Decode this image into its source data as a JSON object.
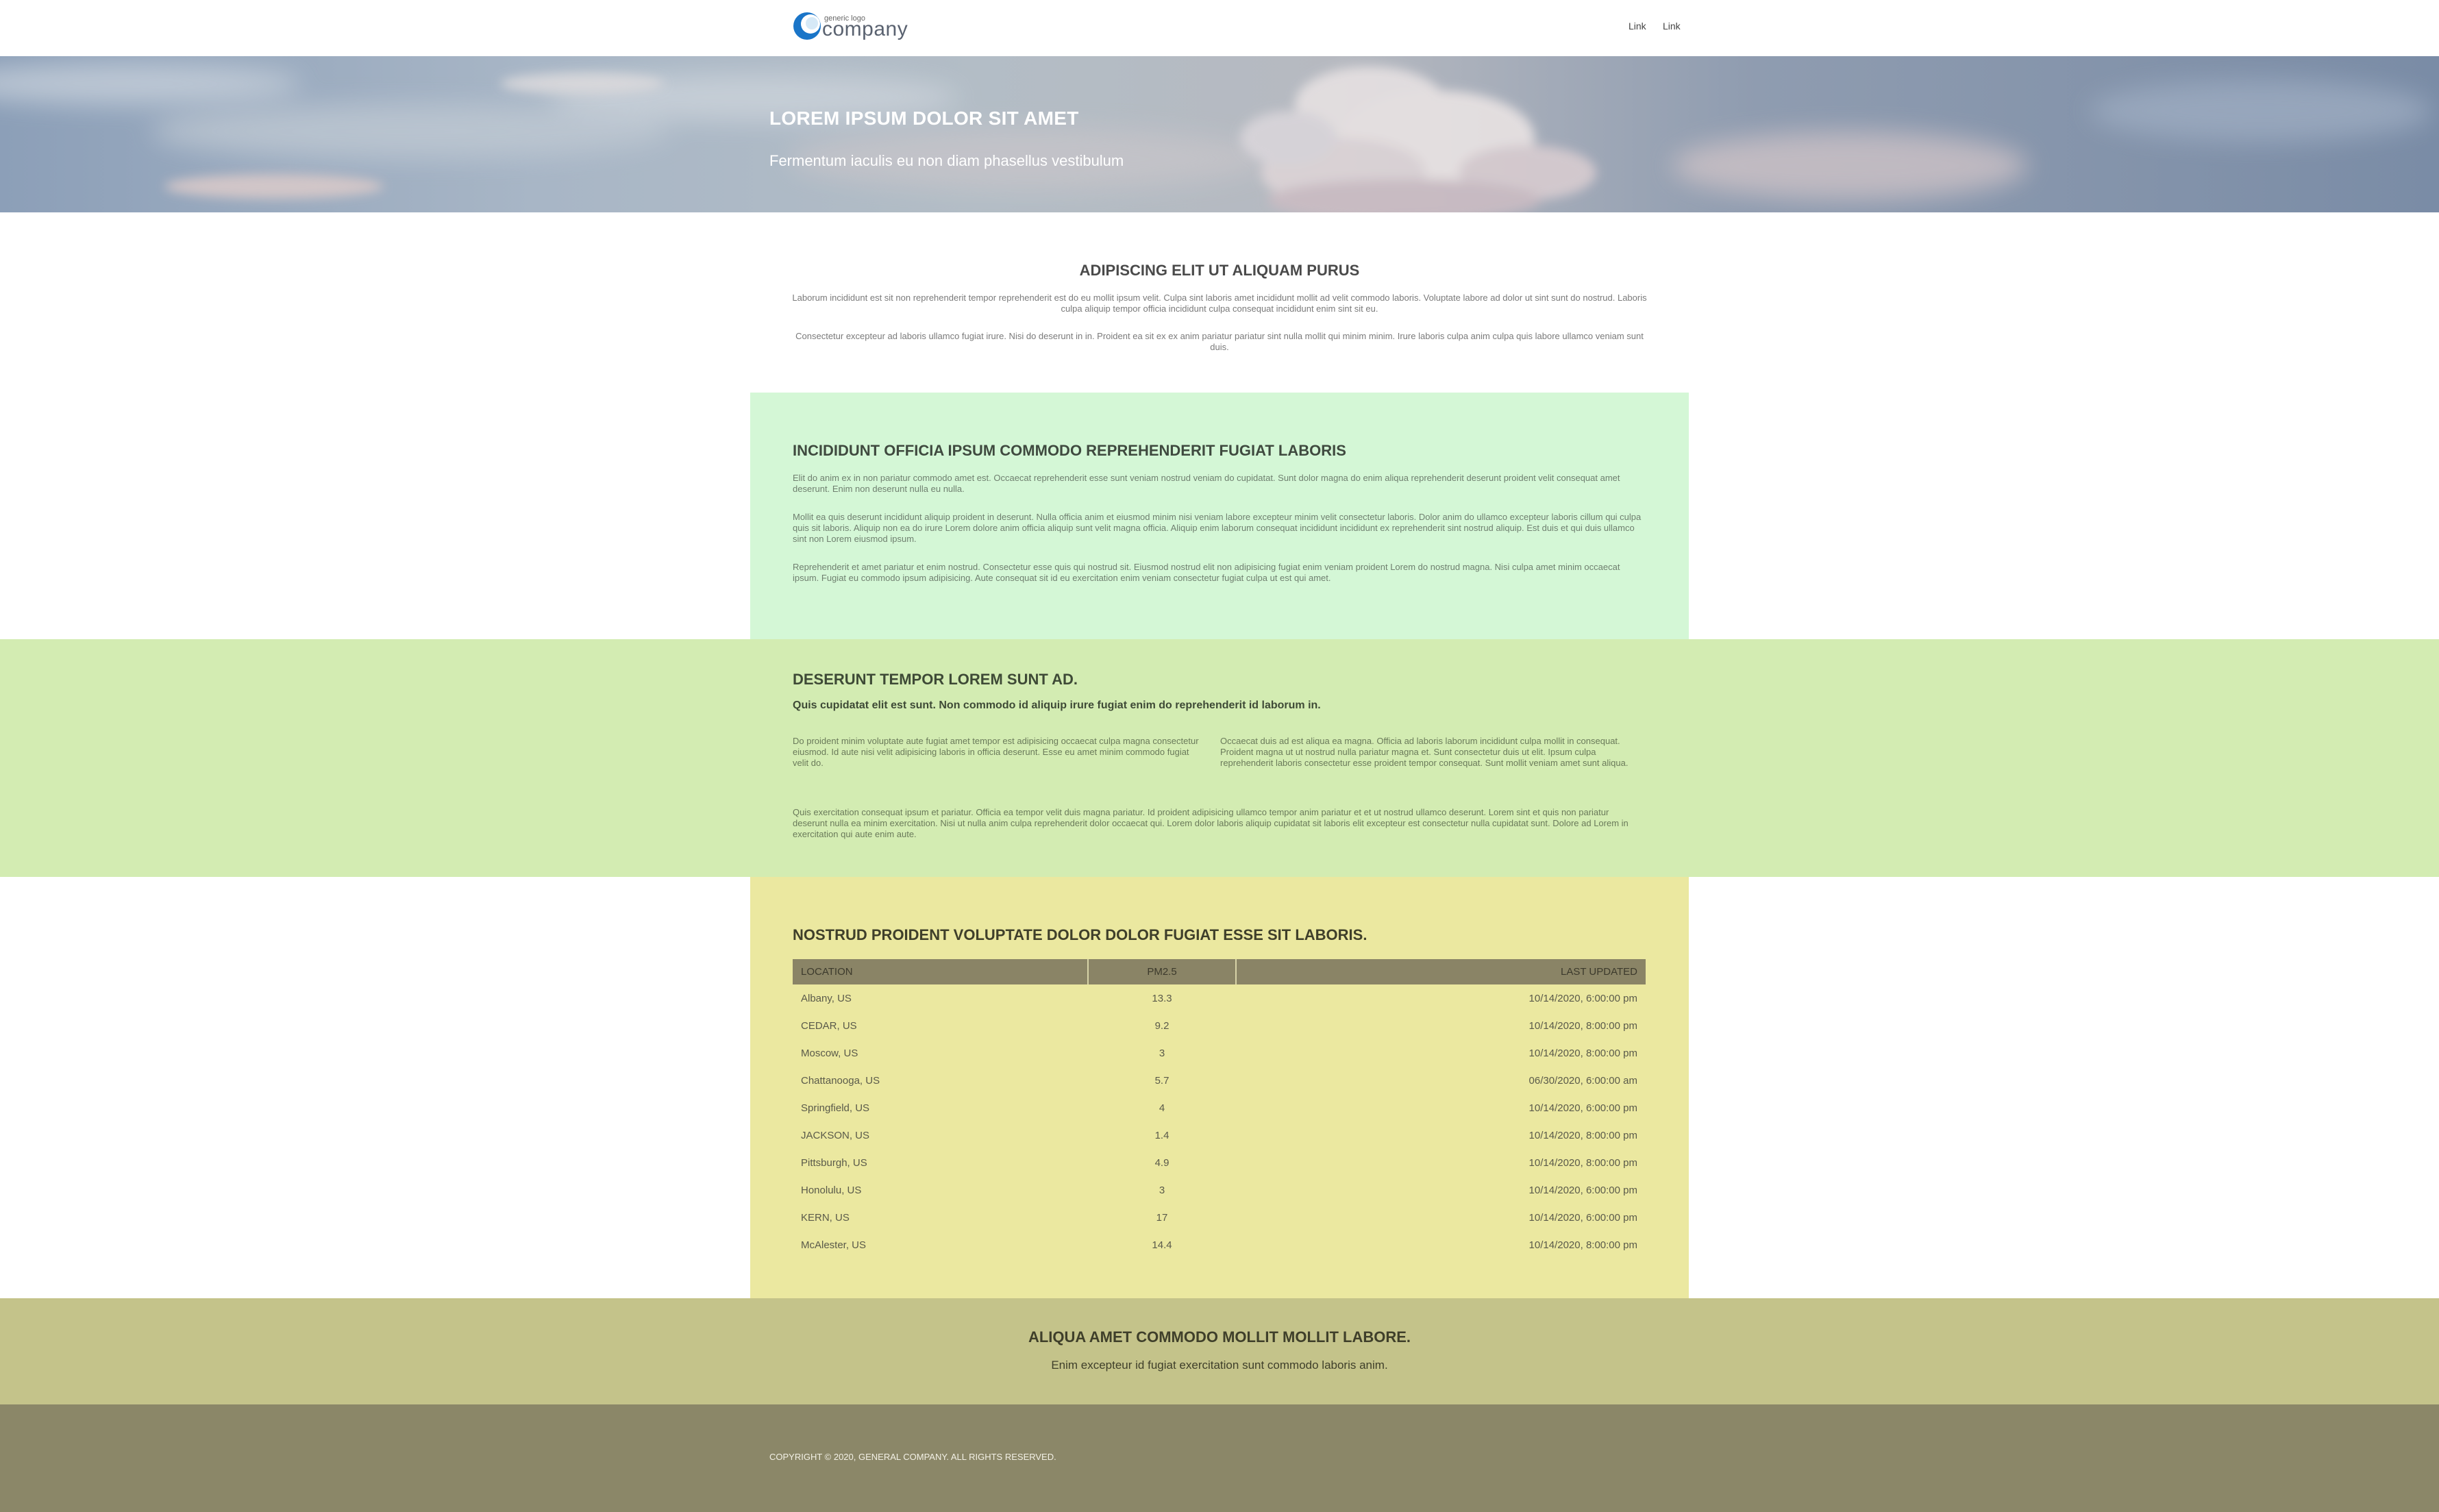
{
  "header": {
    "logo": {
      "small": "generic logo",
      "big": "company"
    },
    "nav": [
      "Link",
      "Link"
    ]
  },
  "hero": {
    "title": "LOREM IPSUM DOLOR SIT AMET",
    "subtitle": "Fermentum iaculis eu non diam phasellus vestibulum"
  },
  "intro": {
    "title": "ADIPISCING ELIT UT ALIQUAM PURUS",
    "paragraphs": [
      "Laborum incididunt est sit non reprehenderit tempor reprehenderit est do eu mollit ipsum velit. Culpa sint laboris amet incididunt mollit ad velit commodo laboris. Voluptate labore ad dolor ut sint sunt do nostrud. Laboris culpa aliquip tempor officia incididunt culpa consequat incididunt enim sint sit eu.",
      "Consectetur excepteur ad laboris ullamco fugiat irure. Nisi do deserunt in in. Proident ea sit ex ex anim pariatur pariatur sint nulla mollit qui minim minim. Irure laboris culpa anim culpa quis labore ullamco veniam sunt duis."
    ]
  },
  "section1": {
    "title": "INCIDIDUNT OFFICIA IPSUM COMMODO REPREHENDERIT FUGIAT LABORIS",
    "paragraphs": [
      "Elit do anim ex in non pariatur commodo amet est. Occaecat reprehenderit esse sunt veniam nostrud veniam do cupidatat. Sunt dolor magna do enim aliqua reprehenderit deserunt proident velit consequat amet deserunt. Enim non deserunt nulla eu nulla.",
      "Mollit ea quis deserunt incididunt aliquip proident in deserunt. Nulla officia anim et eiusmod minim nisi veniam labore excepteur minim velit consectetur laboris. Dolor anim do ullamco excepteur laboris cillum qui culpa quis sit laboris. Aliquip non ea do irure Lorem dolore anim officia aliquip sunt velit magna officia. Aliquip enim laborum consequat incididunt incididunt ex reprehenderit sint nostrud aliquip. Est duis et qui duis ullamco sint non Lorem eiusmod ipsum.",
      "Reprehenderit et amet pariatur et enim nostrud. Consectetur esse quis qui nostrud sit. Eiusmod nostrud elit non adipisicing fugiat enim veniam proident Lorem do nostrud magna. Nisi culpa amet minim occaecat ipsum. Fugiat eu commodo ipsum adipisicing. Aute consequat sit id eu exercitation enim veniam consectetur fugiat culpa ut est qui amet."
    ]
  },
  "section2": {
    "title": "DESERUNT TEMPOR LOREM SUNT AD.",
    "lead": "Quis cupidatat elit est sunt. Non commodo id aliquip irure fugiat enim do reprehenderit id laborum in.",
    "col_left": "Do proident minim voluptate aute fugiat amet tempor est adipisicing occaecat culpa magna consectetur eiusmod. Id aute nisi velit adipisicing laboris in officia deserunt. Esse eu amet minim commodo fugiat velit do.",
    "col_right": "Occaecat duis ad est aliqua ea magna. Officia ad laboris laborum incididunt culpa mollit in consequat. Proident magna ut ut nostrud nulla pariatur magna et. Sunt consectetur duis ut elit. Ipsum culpa reprehenderit laboris consectetur esse proident tempor consequat. Sunt mollit veniam amet sunt aliqua.",
    "closing": "Quis exercitation consequat ipsum et pariatur. Officia ea tempor velit duis magna pariatur. Id proident adipisicing ullamco tempor anim pariatur et et ut nostrud ullamco deserunt. Lorem sint et quis non pariatur deserunt nulla ea minim exercitation. Nisi ut nulla anim culpa reprehenderit dolor occaecat qui. Lorem dolor laboris aliquip cupidatat sit laboris elit excepteur est consectetur nulla cupidatat sunt. Dolore ad Lorem in exercitation qui aute enim aute."
  },
  "section3": {
    "title": "NOSTRUD PROIDENT VOLUPTATE DOLOR DOLOR FUGIAT ESSE SIT LABORIS.",
    "table": {
      "headers": [
        "LOCATION",
        "PM2.5",
        "LAST UPDATED"
      ],
      "rows": [
        [
          "Albany, US",
          "13.3",
          "10/14/2020, 6:00:00 pm"
        ],
        [
          "CEDAR, US",
          "9.2",
          "10/14/2020, 8:00:00 pm"
        ],
        [
          "Moscow, US",
          "3",
          "10/14/2020, 8:00:00 pm"
        ],
        [
          "Chattanooga, US",
          "5.7",
          "06/30/2020, 6:00:00 am"
        ],
        [
          "Springfield, US",
          "4",
          "10/14/2020, 6:00:00 pm"
        ],
        [
          "JACKSON, US",
          "1.4",
          "10/14/2020, 8:00:00 pm"
        ],
        [
          "Pittsburgh, US",
          "4.9",
          "10/14/2020, 8:00:00 pm"
        ],
        [
          "Honolulu, US",
          "3",
          "10/14/2020, 6:00:00 pm"
        ],
        [
          "KERN, US",
          "17",
          "10/14/2020, 6:00:00 pm"
        ],
        [
          "McAlester, US",
          "14.4",
          "10/14/2020, 8:00:00 pm"
        ]
      ]
    }
  },
  "cta": {
    "title": "ALIQUA AMET COMMODO MOLLIT MOLLIT LABORE.",
    "subtitle": "Enim excepteur id fugiat exercitation sunt commodo laboris anim."
  },
  "footer": {
    "copyright": "COPYRIGHT © 2020, GENERAL COMPANY. ALL RIGHTS RESERVED."
  },
  "colors": {
    "green_box": "#d4f7d6",
    "green_band": "#d3ecb2",
    "yellow_box": "#ebe8a0",
    "table_header": "#8a8466",
    "cta_band": "#c4c38a",
    "footer": "#8b8768",
    "logo_blue": "#1a75c8"
  }
}
